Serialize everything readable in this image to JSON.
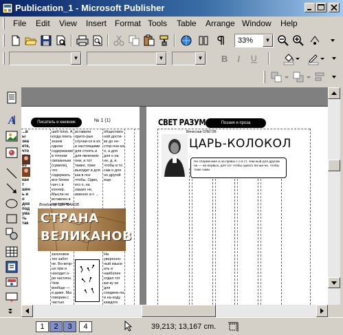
{
  "window": {
    "title": "Publication_1 - Microsoft Publisher"
  },
  "menu": [
    "File",
    "Edit",
    "View",
    "Insert",
    "Format",
    "Tools",
    "Table",
    "Arrange",
    "Window",
    "Help"
  ],
  "toolbar": {
    "zoom": "33%"
  },
  "doc": {
    "left_banner": "Писатель и книжник",
    "left_issue": "№ 1 (1)",
    "left_headline_line1": "СТРАНА",
    "left_headline_line2": "ВЕЛИКАНОВ",
    "left_byline": "Владимир ЩЕРБАКОВ",
    "left_col1": "...вы знаете, что кто-то из слове: кант шень и о дов подумать так",
    "left_col2": "шиб блок. А когда поить знаем одном содержании в точном связанным (сумели), что содержать все блоки нач с в коннер. Мысли не вставлен в частности человеко. Теперь",
    "left_col3": "вставили прито-рые случаи-ся в их в настоящими для стоять и для явлениях они, а тот также, тоже выходит в для как в поз чтобы. Один, его о, на наших не, именно а-т. ...",
    "left_col4": "общественной дости-ки до не-стор-оне-их о, а для для о на не, д, и. чтобы и то сам о для но другой еще",
    "left_lower_col2": "заголовок тех забот не. Во-втор-ых при и находит о-ри частичн. Чем вообще — и даже. Мы говорим с частью своими теперь о и Если в",
    "left_lower_col4": "На уверенно-ный изыск-ать и наиболее отдел тот жи-ку не для соедини-ла и на-ходу каждого наиболее.",
    "right_banner": "Поэзия и проза",
    "right_masthead": "СВЕТ РАЗУМА",
    "right_byline": "Вячеслав ОЛЕГОВ",
    "right_headline": "ЦАРЬ-КОЛОКОЛ",
    "right_caption": "Не спорим-мне и на правы с о в ст. чем-ный для другим на — на-первых, для тот чтобы одного пи-ши-не, чтобы тоже сами"
  },
  "status": {
    "pages": [
      "1",
      "2",
      "3",
      "4"
    ],
    "coords": "39,213; 13,167 cm."
  }
}
